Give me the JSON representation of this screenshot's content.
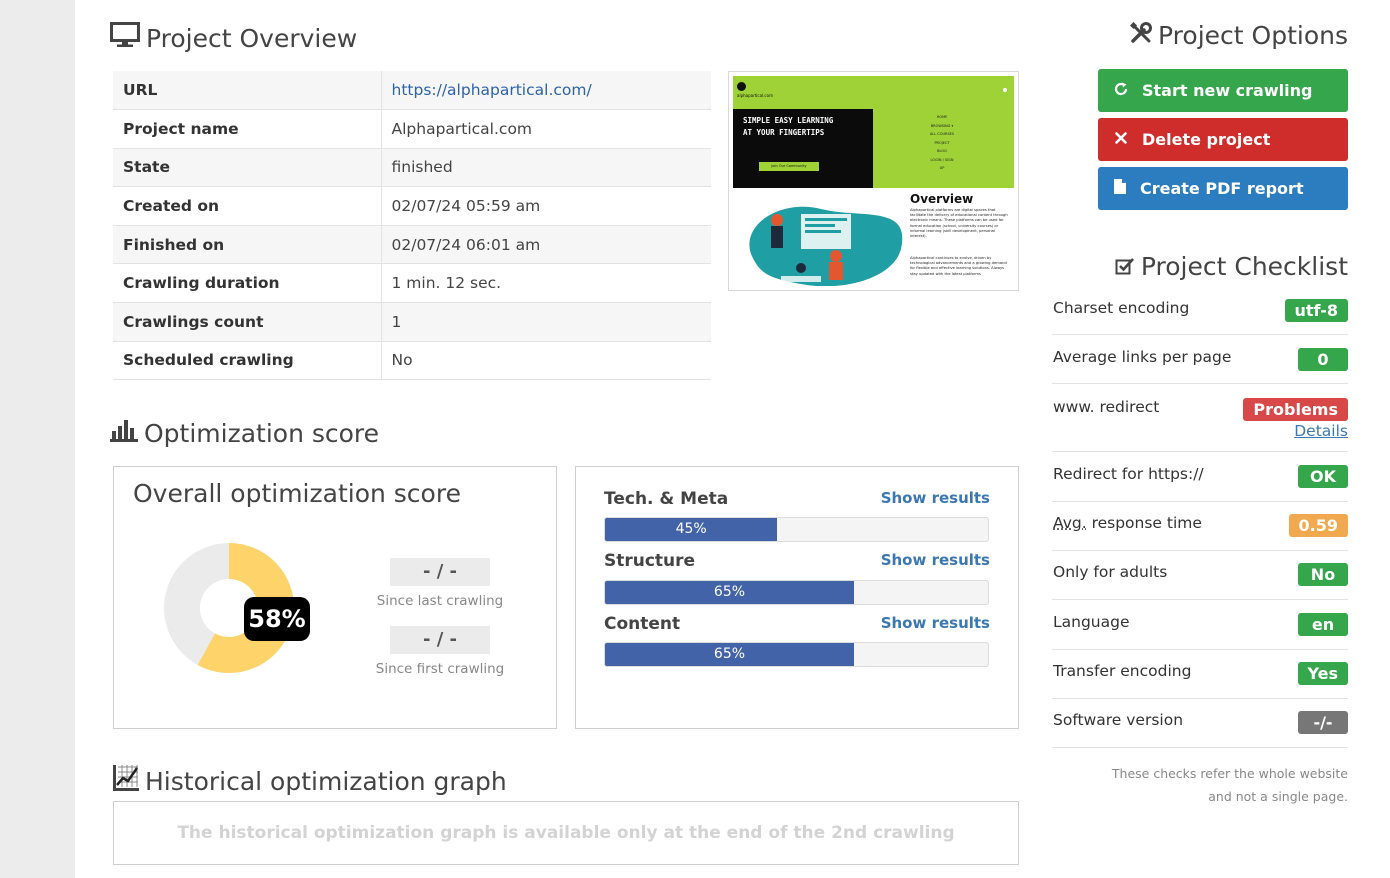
{
  "overview": {
    "title": "Project Overview",
    "rows": [
      {
        "label": "URL",
        "value": "https://alphapartical.com/"
      },
      {
        "label": "Project name",
        "value": "Alphapartical.com"
      },
      {
        "label": "State",
        "value": "finished"
      },
      {
        "label": "Created on",
        "value": "02/07/24 05:59 am"
      },
      {
        "label": "Finished on",
        "value": "02/07/24 06:01 am"
      },
      {
        "label": "Crawling duration",
        "value": "1 min. 12 sec."
      },
      {
        "label": "Crawlings count",
        "value": "1"
      },
      {
        "label": "Scheduled crawling",
        "value": "No"
      }
    ],
    "thumbnail": {
      "logo_text": "alphapartical.com",
      "hero_line1": "SIMPLE EASY LEARNING",
      "hero_line2": "AT YOUR FINGERTIPS",
      "cta": "Join Our Community",
      "menu": [
        "HOME",
        "BROWSING ▾",
        "ALL COURSES",
        "PROJECT",
        "BLOG",
        "LOGIN / SIGN UP"
      ],
      "section_title": "Overview",
      "para1": "Alphapartical platforms are digital spaces that facilitate the delivery of educational content through electronic means. These platforms can be used for formal education (school, university courses) or informal learning (skill development, personal interest).",
      "para2": "Alphapartical continues to evolve, driven by technological advancements and a growing demand for flexible and effective learning solutions. Always stay updated with the latest platforms"
    }
  },
  "score": {
    "title": "Optimization score",
    "overall_title": "Overall optimization score",
    "overall_value": 58,
    "overall_label": "58%",
    "since_last_value": "- / -",
    "since_last_label": "Since last crawling",
    "since_first_value": "- / -",
    "since_first_label": "Since first crawling",
    "categories": [
      {
        "name": "Tech. & Meta",
        "link": "Show results",
        "percent": 45,
        "label": "45%"
      },
      {
        "name": "Structure",
        "link": "Show results",
        "percent": 65,
        "label": "65%"
      },
      {
        "name": "Content",
        "link": "Show results",
        "percent": 65,
        "label": "65%"
      }
    ]
  },
  "history": {
    "title": "Historical optimization graph",
    "message": "The historical optimization graph is available only at the end of the 2nd crawling"
  },
  "options": {
    "title": "Project Options",
    "start": "Start new crawling",
    "delete": "Delete project",
    "pdf": "Create PDF report"
  },
  "checklist": {
    "title": "Project Checklist",
    "items": [
      {
        "label": "Charset encoding",
        "badge": "utf-8",
        "status": "green"
      },
      {
        "label": "Average links per page",
        "badge": "0",
        "status": "green"
      },
      {
        "label": "www. redirect",
        "badge": "Problems",
        "status": "red",
        "link": "Details"
      },
      {
        "label": "Redirect for https://",
        "badge": "OK",
        "status": "green"
      },
      {
        "label_abbr": "Avg.",
        "label_rest": " response time",
        "badge": "0.59",
        "status": "orange"
      },
      {
        "label": "Only for adults",
        "badge": "No",
        "status": "green"
      },
      {
        "label": "Language",
        "badge": "en",
        "status": "green"
      },
      {
        "label": "Transfer encoding",
        "badge": "Yes",
        "status": "green"
      },
      {
        "label": "Software version",
        "badge": "-/-",
        "status": "gray"
      }
    ],
    "note_line1": "These checks refer the whole website",
    "note_line2": "and not a single page."
  },
  "colors": {
    "accent_blue": "#4363a8",
    "donut_fill": "#fdd36a",
    "donut_bg": "#ebebeb",
    "green": "#35a64c",
    "red": "#cf2c2c",
    "blue": "#2c7dbf",
    "orange": "#f0a94e"
  }
}
